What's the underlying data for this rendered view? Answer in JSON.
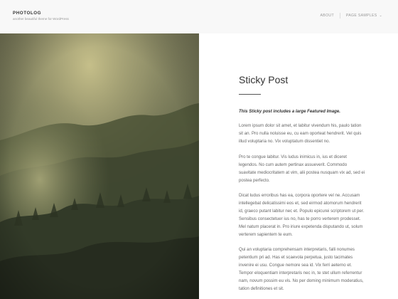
{
  "site": {
    "title": "PHOTOLOG",
    "description": "another beautiful theme for WordPress"
  },
  "nav": {
    "items": [
      {
        "label": "ABOUT"
      },
      {
        "label": "PAGE SAMPLES"
      }
    ]
  },
  "featured_image": {
    "description_icon": "misty-forest-photo"
  },
  "post": {
    "title": "Sticky Post",
    "lead": "This Sticky post includes a large Featured Image.",
    "paragraphs": [
      "Lorem ipsum dolor sit amet, et labitur vivendum his, paulo tation sit an. Pro nulla noluisse eu, cu eam oporteat hendrerit. Vel quis illud voluptaria no. Vix voluptatum dissentiet no.",
      "Pro te congue labitur. Vis ludus inimicus in, ius et diceret legendos. No cum autem pertinax assueverit. Commodo suavitate mediocritatem at vim, alii postea nusquam vix ad, sed ei postea perfecto.",
      "Dicat ludus erroribus has ea, corpora oportere vel ne. Accusam intellegebat delicatissimi eos et, sed eirmod atomorum hendrerit id, graeco putant labitur nec et. Populo epicurei scriptorem ut per. Sensibus consectetuer ius no, has te porro verterem prodesset. Mel natum placerat in. Pro iriure expetenda disputando ut, solum verterem sapientem te eum.",
      "Qui an voluptaria comprehensam interpretaris, falli nonumes petentium pri ad. Has et scaevola perpetua, justo tacimates invenire ei usu. Congue nemore sea id. Vix ferri aeterno et. Tempor eloquentiam interpretaris nec in, te stet ullum referrentur nam, novum possim eu vis. No per doming minimum moderatius, tation definitiones et sit."
    ]
  },
  "colors": {
    "header_bg": "#f8f8f8",
    "content_bg": "#ffffff",
    "title": "#333333",
    "body_text": "#666666"
  }
}
